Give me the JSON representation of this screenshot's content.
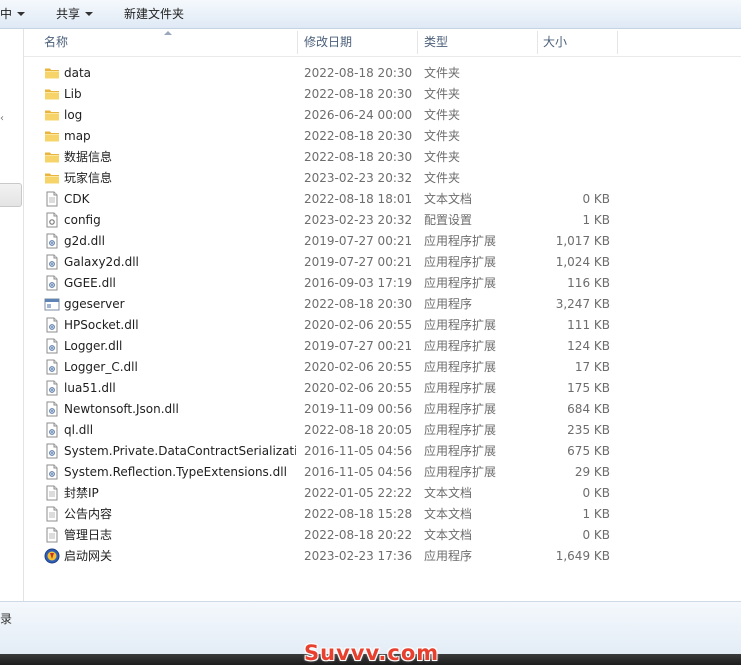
{
  "toolbar": {
    "items": [
      {
        "label": "中",
        "dropdown": true
      },
      {
        "label": "共享",
        "dropdown": true
      },
      {
        "label": "新建文件夹",
        "dropdown": false
      }
    ]
  },
  "columns": {
    "name": "名称",
    "date": "修改日期",
    "type": "类型",
    "size": "大小"
  },
  "files": [
    {
      "name": "data",
      "date": "2022-08-18 20:30",
      "type": "文件夹",
      "size": "",
      "icon": "folder-icon"
    },
    {
      "name": "Lib",
      "date": "2022-08-18 20:30",
      "type": "文件夹",
      "size": "",
      "icon": "folder-icon"
    },
    {
      "name": "log",
      "date": "2026-06-24 00:00",
      "type": "文件夹",
      "size": "",
      "icon": "folder-icon"
    },
    {
      "name": "map",
      "date": "2022-08-18 20:30",
      "type": "文件夹",
      "size": "",
      "icon": "folder-icon"
    },
    {
      "name": "数据信息",
      "date": "2022-08-18 20:30",
      "type": "文件夹",
      "size": "",
      "icon": "folder-icon"
    },
    {
      "name": "玩家信息",
      "date": "2023-02-23 20:32",
      "type": "文件夹",
      "size": "",
      "icon": "folder-icon"
    },
    {
      "name": "CDK",
      "date": "2022-08-18 18:01",
      "type": "文本文档",
      "size": "0 KB",
      "icon": "text-document-icon"
    },
    {
      "name": "config",
      "date": "2023-02-23 20:32",
      "type": "配置设置",
      "size": "1 KB",
      "icon": "config-file-icon"
    },
    {
      "name": "g2d.dll",
      "date": "2019-07-27 00:21",
      "type": "应用程序扩展",
      "size": "1,017 KB",
      "icon": "dll-file-icon"
    },
    {
      "name": "Galaxy2d.dll",
      "date": "2019-07-27 00:21",
      "type": "应用程序扩展",
      "size": "1,024 KB",
      "icon": "dll-file-icon"
    },
    {
      "name": "GGEE.dll",
      "date": "2016-09-03 17:19",
      "type": "应用程序扩展",
      "size": "116 KB",
      "icon": "dll-file-icon"
    },
    {
      "name": "ggeserver",
      "date": "2022-08-18 20:30",
      "type": "应用程序",
      "size": "3,247 KB",
      "icon": "application-icon"
    },
    {
      "name": "HPSocket.dll",
      "date": "2020-02-06 20:55",
      "type": "应用程序扩展",
      "size": "111 KB",
      "icon": "dll-file-icon"
    },
    {
      "name": "Logger.dll",
      "date": "2019-07-27 00:21",
      "type": "应用程序扩展",
      "size": "124 KB",
      "icon": "dll-file-icon"
    },
    {
      "name": "Logger_C.dll",
      "date": "2020-02-06 20:55",
      "type": "应用程序扩展",
      "size": "17 KB",
      "icon": "dll-file-icon"
    },
    {
      "name": "lua51.dll",
      "date": "2020-02-06 20:55",
      "type": "应用程序扩展",
      "size": "175 KB",
      "icon": "dll-file-icon"
    },
    {
      "name": "Newtonsoft.Json.dll",
      "date": "2019-11-09 00:56",
      "type": "应用程序扩展",
      "size": "684 KB",
      "icon": "dll-file-icon"
    },
    {
      "name": "ql.dll",
      "date": "2022-08-18 20:05",
      "type": "应用程序扩展",
      "size": "235 KB",
      "icon": "dll-file-icon"
    },
    {
      "name": "System.Private.DataContractSerializati...",
      "date": "2016-11-05 04:56",
      "type": "应用程序扩展",
      "size": "675 KB",
      "icon": "dll-file-icon"
    },
    {
      "name": "System.Reflection.TypeExtensions.dll",
      "date": "2016-11-05 04:56",
      "type": "应用程序扩展",
      "size": "29 KB",
      "icon": "dll-file-icon"
    },
    {
      "name": "封禁IP",
      "date": "2022-01-05 22:22",
      "type": "文本文档",
      "size": "0 KB",
      "icon": "text-document-icon"
    },
    {
      "name": "公告内容",
      "date": "2022-08-18 15:28",
      "type": "文本文档",
      "size": "1 KB",
      "icon": "text-document-icon"
    },
    {
      "name": "管理日志",
      "date": "2022-08-18 20:22",
      "type": "文本文档",
      "size": "0 KB",
      "icon": "text-document-icon"
    },
    {
      "name": "启动网关",
      "date": "2023-02-23 17:36",
      "type": "应用程序",
      "size": "1,649 KB",
      "icon": "gateway-app-icon"
    }
  ],
  "nav": {
    "glyph_top": "‹",
    "glyph_bottom": "‹"
  },
  "status": {
    "glyph": "录"
  },
  "watermark": "Suvvv.com",
  "colors": {
    "folder": "#f1c44e",
    "header_text": "#4c607a",
    "muted_text": "#6d6d6d",
    "watermark": "#e8402f"
  }
}
